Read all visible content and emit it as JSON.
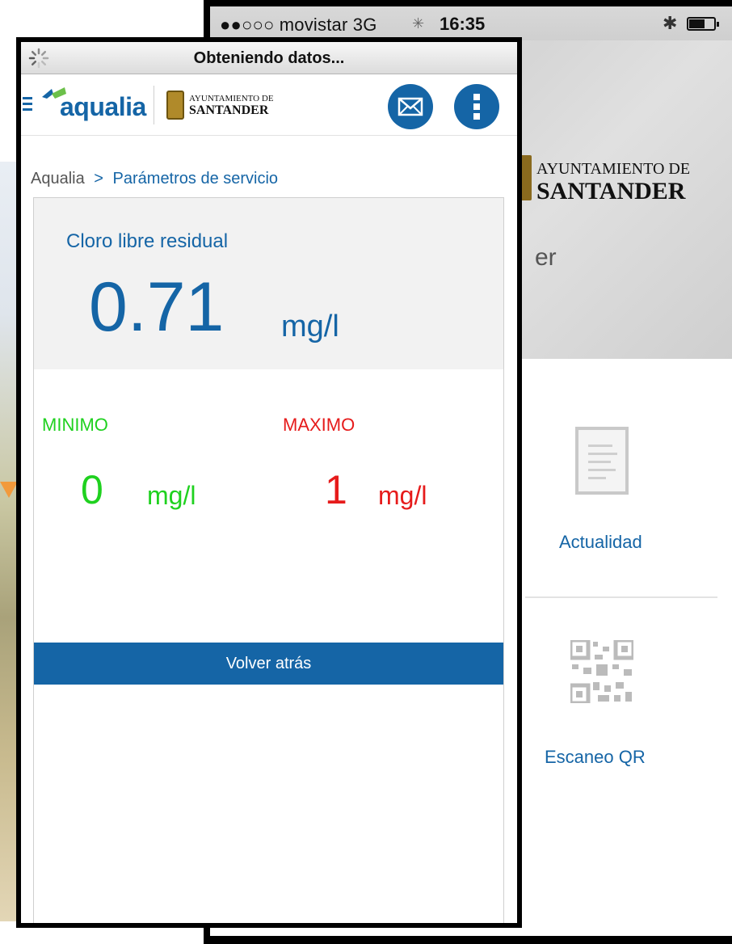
{
  "background_app": {
    "status_bar": {
      "carrier": "●●○○○ movistar  3G",
      "time": "16:35"
    },
    "hero": {
      "org_line1": "AYUNTAMIENTO DE",
      "org_line2": "SANTANDER",
      "fragment": "er"
    },
    "tiles": [
      {
        "label": "Actualidad",
        "icon": "document-icon"
      },
      {
        "label": "Escaneo QR",
        "icon": "qr-code-icon"
      }
    ]
  },
  "foreground_app": {
    "loading_title": "Obteniendo datos...",
    "header": {
      "brand": "aqualia",
      "org_line1": "AYUNTAMIENTO DE",
      "org_line2": "SANTANDER",
      "buttons": [
        "mail-icon",
        "more-vertical-icon"
      ]
    },
    "breadcrumb": {
      "root": "Aqualia",
      "separator": ">",
      "current": "Parámetros de servicio"
    },
    "parameter": {
      "name": "Cloro libre residual",
      "value": "0.71",
      "unit": "mg/l"
    },
    "limits": {
      "min": {
        "label": "MINIMO",
        "value": "0",
        "unit": "mg/l"
      },
      "max": {
        "label": "MAXIMO",
        "value": "1",
        "unit": "mg/l"
      }
    },
    "back_button": "Volver atrás"
  },
  "colors": {
    "primary_blue": "#1565a6",
    "min_green": "#1fd11f",
    "max_red": "#e61b1b",
    "card_gray": "#f2f2f2"
  }
}
